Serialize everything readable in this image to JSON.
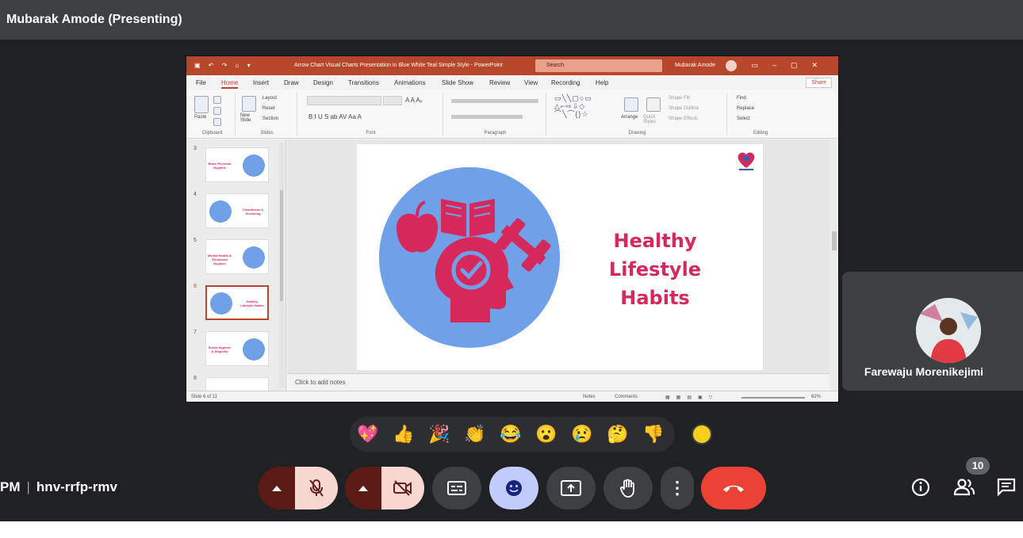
{
  "presenter_bar": {
    "title": "Mubarak Amode (Presenting)"
  },
  "powerpoint": {
    "window_title": "Arrow Chart Visual Charts Presentation in Blue White Teal Simple Style - PowerPoint",
    "search_placeholder": "Search",
    "account_name": "Mubarak Amode",
    "menu": [
      "File",
      "Home",
      "Insert",
      "Draw",
      "Design",
      "Transitions",
      "Animations",
      "Slide Show",
      "Review",
      "View",
      "Recording",
      "Help"
    ],
    "active_menu": "Home",
    "share_label": "Share",
    "ribbon": {
      "clipboard": {
        "paste": "Paste",
        "group": "Clipboard"
      },
      "slides": {
        "new_slide": "New Slide",
        "layout": "Layout",
        "reset": "Reset",
        "section": "Section",
        "group": "Slides"
      },
      "font": {
        "group": "Font"
      },
      "paragraph": {
        "group": "Paragraph"
      },
      "drawing": {
        "arrange": "Arrange",
        "quick_styles": "Quick Styles",
        "shape_fill": "Shape Fill",
        "shape_outline": "Shape Outline",
        "shape_effects": "Shape Effects",
        "group": "Drawing"
      },
      "editing": {
        "find": "Find",
        "replace": "Replace",
        "select": "Select",
        "group": "Editing"
      }
    },
    "thumbnails": [
      {
        "number": "3",
        "title": "Basic Personal Hygiene"
      },
      {
        "number": "4",
        "title": "Cleanliness & Grooming"
      },
      {
        "number": "5",
        "title": "Mental Health & Emotional Hygiene"
      },
      {
        "number": "6",
        "title": "Healthy Lifestyle Habits",
        "active": true
      },
      {
        "number": "7",
        "title": "Social Hygiene & Etiquette"
      },
      {
        "number": "8",
        "title": ""
      }
    ],
    "slide": {
      "title_line1": "Healthy",
      "title_line2": "Lifestyle Habits",
      "accent_color": "#d6295b",
      "circle_color": "#6fa0e8"
    },
    "notes_placeholder": "Click to add notes",
    "status": {
      "slide_count": "Slide 6 of 11",
      "notes": "Notes",
      "comments": "Comments",
      "zoom": "62%"
    }
  },
  "participant": {
    "name": "Farewaju Morenikejimi"
  },
  "reactions": [
    {
      "icon": "sparkling-heart",
      "glyph": "💖"
    },
    {
      "icon": "thumbs-up",
      "glyph": "👍"
    },
    {
      "icon": "party-popper",
      "glyph": "🎉"
    },
    {
      "icon": "clapping-hands",
      "glyph": "👏"
    },
    {
      "icon": "tears-of-joy",
      "glyph": "😂"
    },
    {
      "icon": "surprised-face",
      "glyph": "😮"
    },
    {
      "icon": "sad-face",
      "glyph": "😢"
    },
    {
      "icon": "thinking-face",
      "glyph": "🤔"
    },
    {
      "icon": "thumbs-down",
      "glyph": "👎"
    }
  ],
  "meeting": {
    "time_fragment": "PM",
    "separator": "|",
    "code": "hnv-rrfp-rmv"
  },
  "people_count": "10",
  "colors": {
    "leave_red": "#ea4335",
    "mic_off_bg": "#f8d8d1",
    "emoji_btn_bg": "#c2cdfc",
    "ppt_red": "#b7472a"
  }
}
